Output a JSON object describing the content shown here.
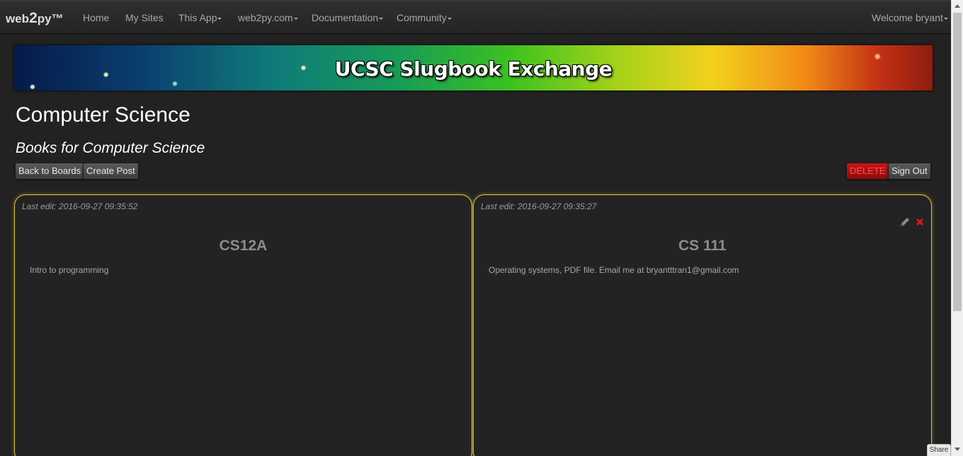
{
  "navbar": {
    "brand_prefix": "web",
    "brand_big": "2",
    "brand_suffix": "py™",
    "items": [
      {
        "label": "Home",
        "dropdown": false
      },
      {
        "label": "My Sites",
        "dropdown": false
      },
      {
        "label": "This App",
        "dropdown": true
      },
      {
        "label": "web2py.com",
        "dropdown": true
      },
      {
        "label": "Documentation",
        "dropdown": true
      },
      {
        "label": "Community",
        "dropdown": true
      }
    ],
    "user_menu": "Welcome bryant"
  },
  "banner": {
    "title": "UCSC Slugbook Exchange"
  },
  "page": {
    "title": "Computer Science",
    "subtitle": "Books for Computer Science"
  },
  "buttons": {
    "back": "Back to Boards",
    "create": "Create Post",
    "delete": "DELETE",
    "signout": "Sign Out"
  },
  "posts": [
    {
      "last_edit": "Last edit: 2016-09-27 09:35:52",
      "title": "CS12A",
      "body": "Intro to programming"
    },
    {
      "last_edit": "Last edit: 2016-09-27 09:35:27",
      "title": "CS 111",
      "body": "Operating systems, PDF file. Email me at bryantttran1@gmail.com"
    }
  ],
  "share": {
    "label": "Share"
  },
  "colors": {
    "accent": "#e2c431",
    "danger": "#c81515",
    "background": "#222222"
  },
  "icons": {
    "edit": "pencil-icon",
    "delete": "close-icon"
  }
}
